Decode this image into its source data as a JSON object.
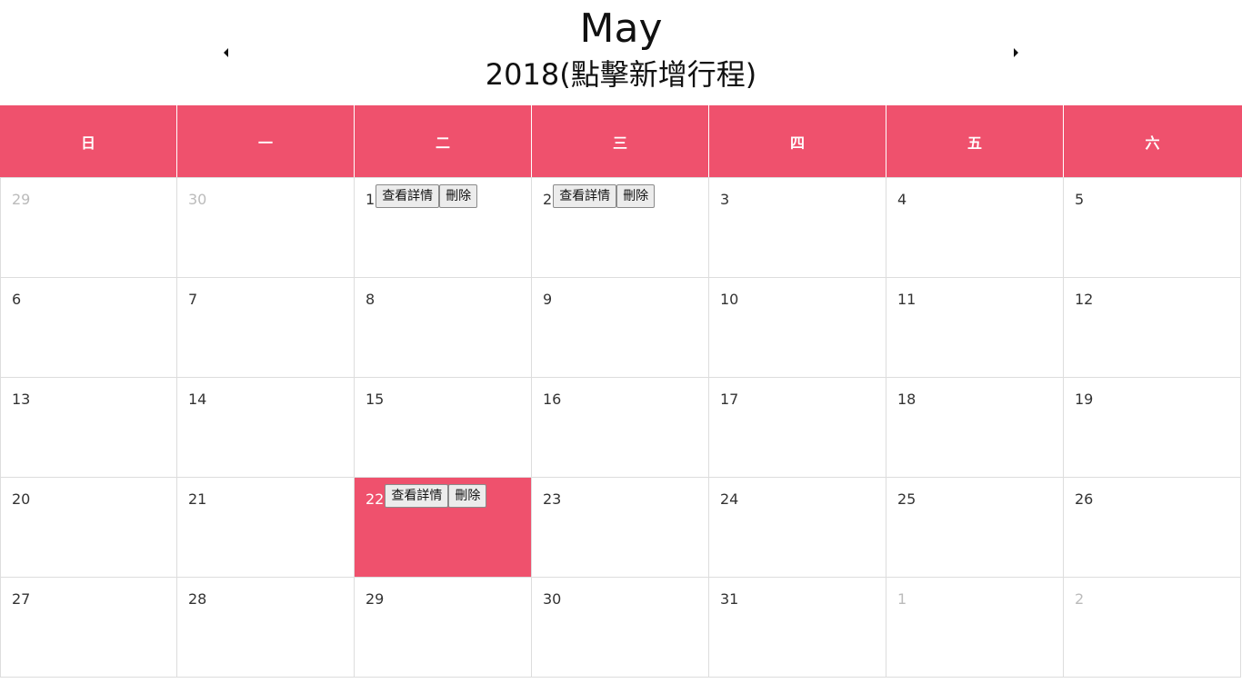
{
  "header": {
    "month": "May",
    "year_line": "2018(點擊新增行程)"
  },
  "icons": {
    "prev": "caret-left-icon",
    "next": "caret-right-icon"
  },
  "colors": {
    "accent": "#ef516d",
    "border": "#dddddd",
    "muted_text": "#bbbbbb"
  },
  "weekdays": [
    "日",
    "一",
    "二",
    "三",
    "四",
    "五",
    "六"
  ],
  "buttons": {
    "details_label": "查看詳情",
    "delete_label": "刪除"
  },
  "weeks": [
    [
      {
        "day": "29",
        "other": true
      },
      {
        "day": "30",
        "other": true
      },
      {
        "day": "1",
        "event": true
      },
      {
        "day": "2",
        "event": true
      },
      {
        "day": "3"
      },
      {
        "day": "4"
      },
      {
        "day": "5"
      }
    ],
    [
      {
        "day": "6"
      },
      {
        "day": "7"
      },
      {
        "day": "8"
      },
      {
        "day": "9"
      },
      {
        "day": "10"
      },
      {
        "day": "11"
      },
      {
        "day": "12"
      }
    ],
    [
      {
        "day": "13"
      },
      {
        "day": "14"
      },
      {
        "day": "15"
      },
      {
        "day": "16"
      },
      {
        "day": "17"
      },
      {
        "day": "18"
      },
      {
        "day": "19"
      }
    ],
    [
      {
        "day": "20"
      },
      {
        "day": "21"
      },
      {
        "day": "22",
        "today": true,
        "event": true
      },
      {
        "day": "23"
      },
      {
        "day": "24"
      },
      {
        "day": "25"
      },
      {
        "day": "26"
      }
    ],
    [
      {
        "day": "27"
      },
      {
        "day": "28"
      },
      {
        "day": "29"
      },
      {
        "day": "30"
      },
      {
        "day": "31"
      },
      {
        "day": "1",
        "other": true
      },
      {
        "day": "2",
        "other": true
      }
    ]
  ]
}
